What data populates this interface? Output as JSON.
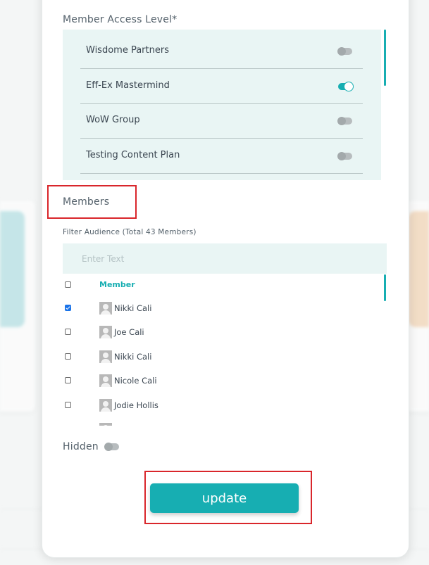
{
  "access": {
    "label": "Member Access Level*",
    "items": [
      {
        "name": "Wisdome Partners",
        "enabled": false
      },
      {
        "name": "Eff-Ex Mastermind",
        "enabled": true
      },
      {
        "name": "WoW Group",
        "enabled": false
      },
      {
        "name": "Testing Content Plan",
        "enabled": false
      }
    ]
  },
  "members": {
    "section_title": "Members",
    "filter_label": "Filter Audience (Total 43 Members)",
    "filter_placeholder": "Enter Text",
    "column_header": "Member",
    "rows": [
      {
        "name": "Nikki Cali",
        "checked": true
      },
      {
        "name": "Joe Cali",
        "checked": false
      },
      {
        "name": "Nikki Cali",
        "checked": false
      },
      {
        "name": "Nicole Cali",
        "checked": false
      },
      {
        "name": "Jodie Hollis",
        "checked": false
      }
    ]
  },
  "hidden": {
    "label": "Hidden",
    "enabled": false
  },
  "update_label": "update",
  "colors": {
    "accent": "#17aeb2",
    "highlight": "#d9262b",
    "panel": "#e9f5f4"
  }
}
